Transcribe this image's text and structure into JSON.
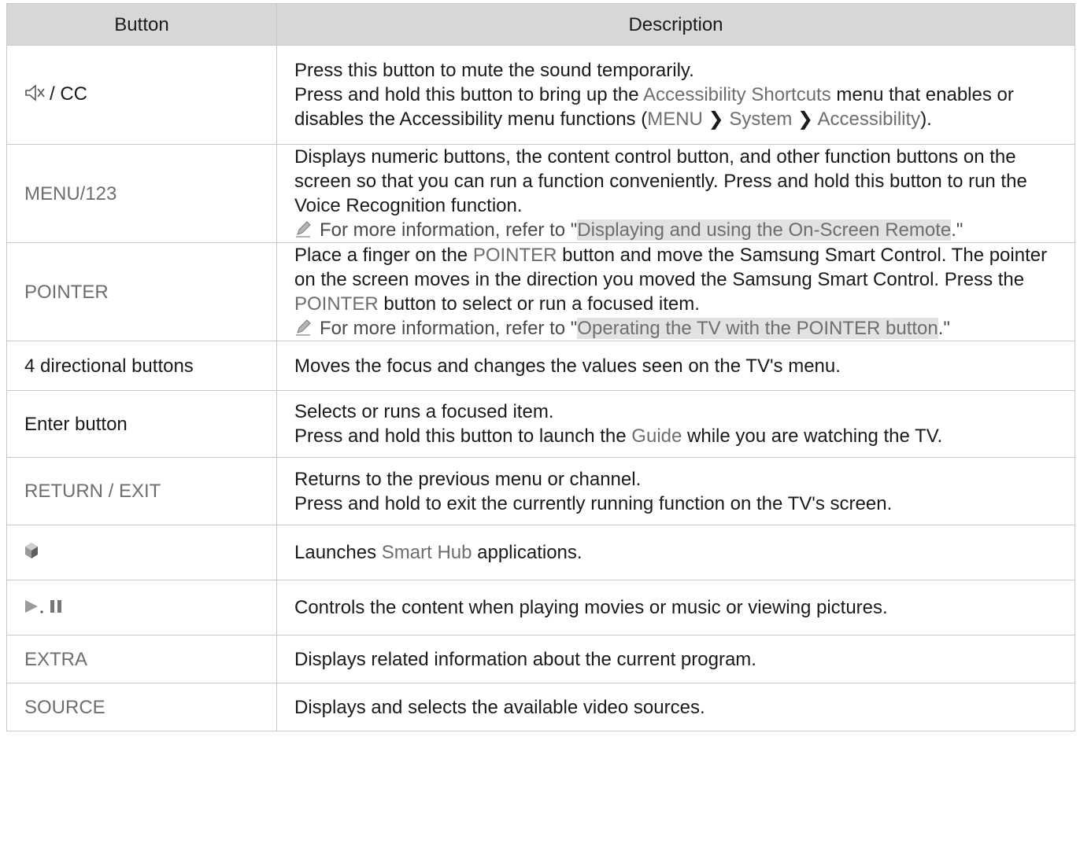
{
  "headers": {
    "button": "Button",
    "description": "Description"
  },
  "rows": [
    {
      "button": {
        "icon": "mute-icon",
        "text": "/ CC"
      },
      "lines": [
        [
          {
            "t": "Press this button to mute the sound temporarily."
          }
        ],
        [
          {
            "t": "Press and hold this button to bring up the "
          },
          {
            "t": "Accessibility Shortcuts",
            "s": "hl"
          },
          {
            "t": " menu that enables or disables the Accessibility menu functions ("
          },
          {
            "t": "MENU",
            "s": "hl"
          },
          {
            "t": " ❯ "
          },
          {
            "t": "System",
            "s": "hl"
          },
          {
            "t": " ❯ "
          },
          {
            "t": "Accessibility",
            "s": "hl"
          },
          {
            "t": ")."
          }
        ]
      ]
    },
    {
      "button": {
        "text": "MENU/123",
        "s": "hl"
      },
      "lines": [
        [
          {
            "t": "Displays numeric buttons, the content control button, and other function buttons on the screen so that you can run a function conveniently. Press and hold this button to run the Voice Recognition function."
          }
        ],
        [
          {
            "icon": "pencil-note-icon"
          },
          {
            "t": "For more information, refer to \"",
            "s": "note"
          },
          {
            "t": "Displaying and using the On-Screen Remote",
            "s": "link"
          },
          {
            "t": ".\"",
            "s": "note"
          }
        ]
      ]
    },
    {
      "button": {
        "text": "POINTER",
        "s": "hl"
      },
      "lines": [
        [
          {
            "t": "Place a finger on the "
          },
          {
            "t": "POINTER",
            "s": "hl"
          },
          {
            "t": " button and move the Samsung Smart Control. The pointer on the screen moves in the direction you moved the Samsung Smart Control. Press the "
          },
          {
            "t": "POINTER",
            "s": "hl"
          },
          {
            "t": " button to select or run a focused item."
          }
        ],
        [
          {
            "icon": "pencil-note-icon"
          },
          {
            "t": "For more information, refer to \"",
            "s": "note"
          },
          {
            "t": "Operating the TV with the POINTER button",
            "s": "link"
          },
          {
            "t": ".\"",
            "s": "note"
          }
        ]
      ]
    },
    {
      "button": {
        "text": "4 directional buttons"
      },
      "lines": [
        [
          {
            "t": "Moves the focus and changes the values seen on the TV's menu."
          }
        ]
      ]
    },
    {
      "button": {
        "text": "Enter button"
      },
      "lines": [
        [
          {
            "t": "Selects or runs a focused item."
          }
        ],
        [
          {
            "t": "Press and hold this button to launch the "
          },
          {
            "t": "Guide",
            "s": "hl"
          },
          {
            "t": " while you are watching the TV."
          }
        ]
      ]
    },
    {
      "button": {
        "text": "RETURN / EXIT",
        "s": "hl"
      },
      "lines": [
        [
          {
            "t": "Returns to the previous menu or channel."
          }
        ],
        [
          {
            "t": "Press and hold to exit the currently running function on the TV's screen."
          }
        ]
      ]
    },
    {
      "button": {
        "icon": "smart-hub-icon"
      },
      "lines": [
        [
          {
            "t": "Launches "
          },
          {
            "t": "Smart Hub",
            "s": "hl"
          },
          {
            "t": " applications."
          }
        ]
      ]
    },
    {
      "button": {
        "icon": "play-pause-icon"
      },
      "lines": [
        [
          {
            "t": "Controls the content when playing movies or music or viewing pictures."
          }
        ]
      ]
    },
    {
      "button": {
        "text": "EXTRA",
        "s": "hl"
      },
      "lines": [
        [
          {
            "t": "Displays related information about the current program."
          }
        ]
      ]
    },
    {
      "button": {
        "text": "SOURCE",
        "s": "hl"
      },
      "lines": [
        [
          {
            "t": "Displays and selects the available video sources."
          }
        ]
      ]
    }
  ]
}
